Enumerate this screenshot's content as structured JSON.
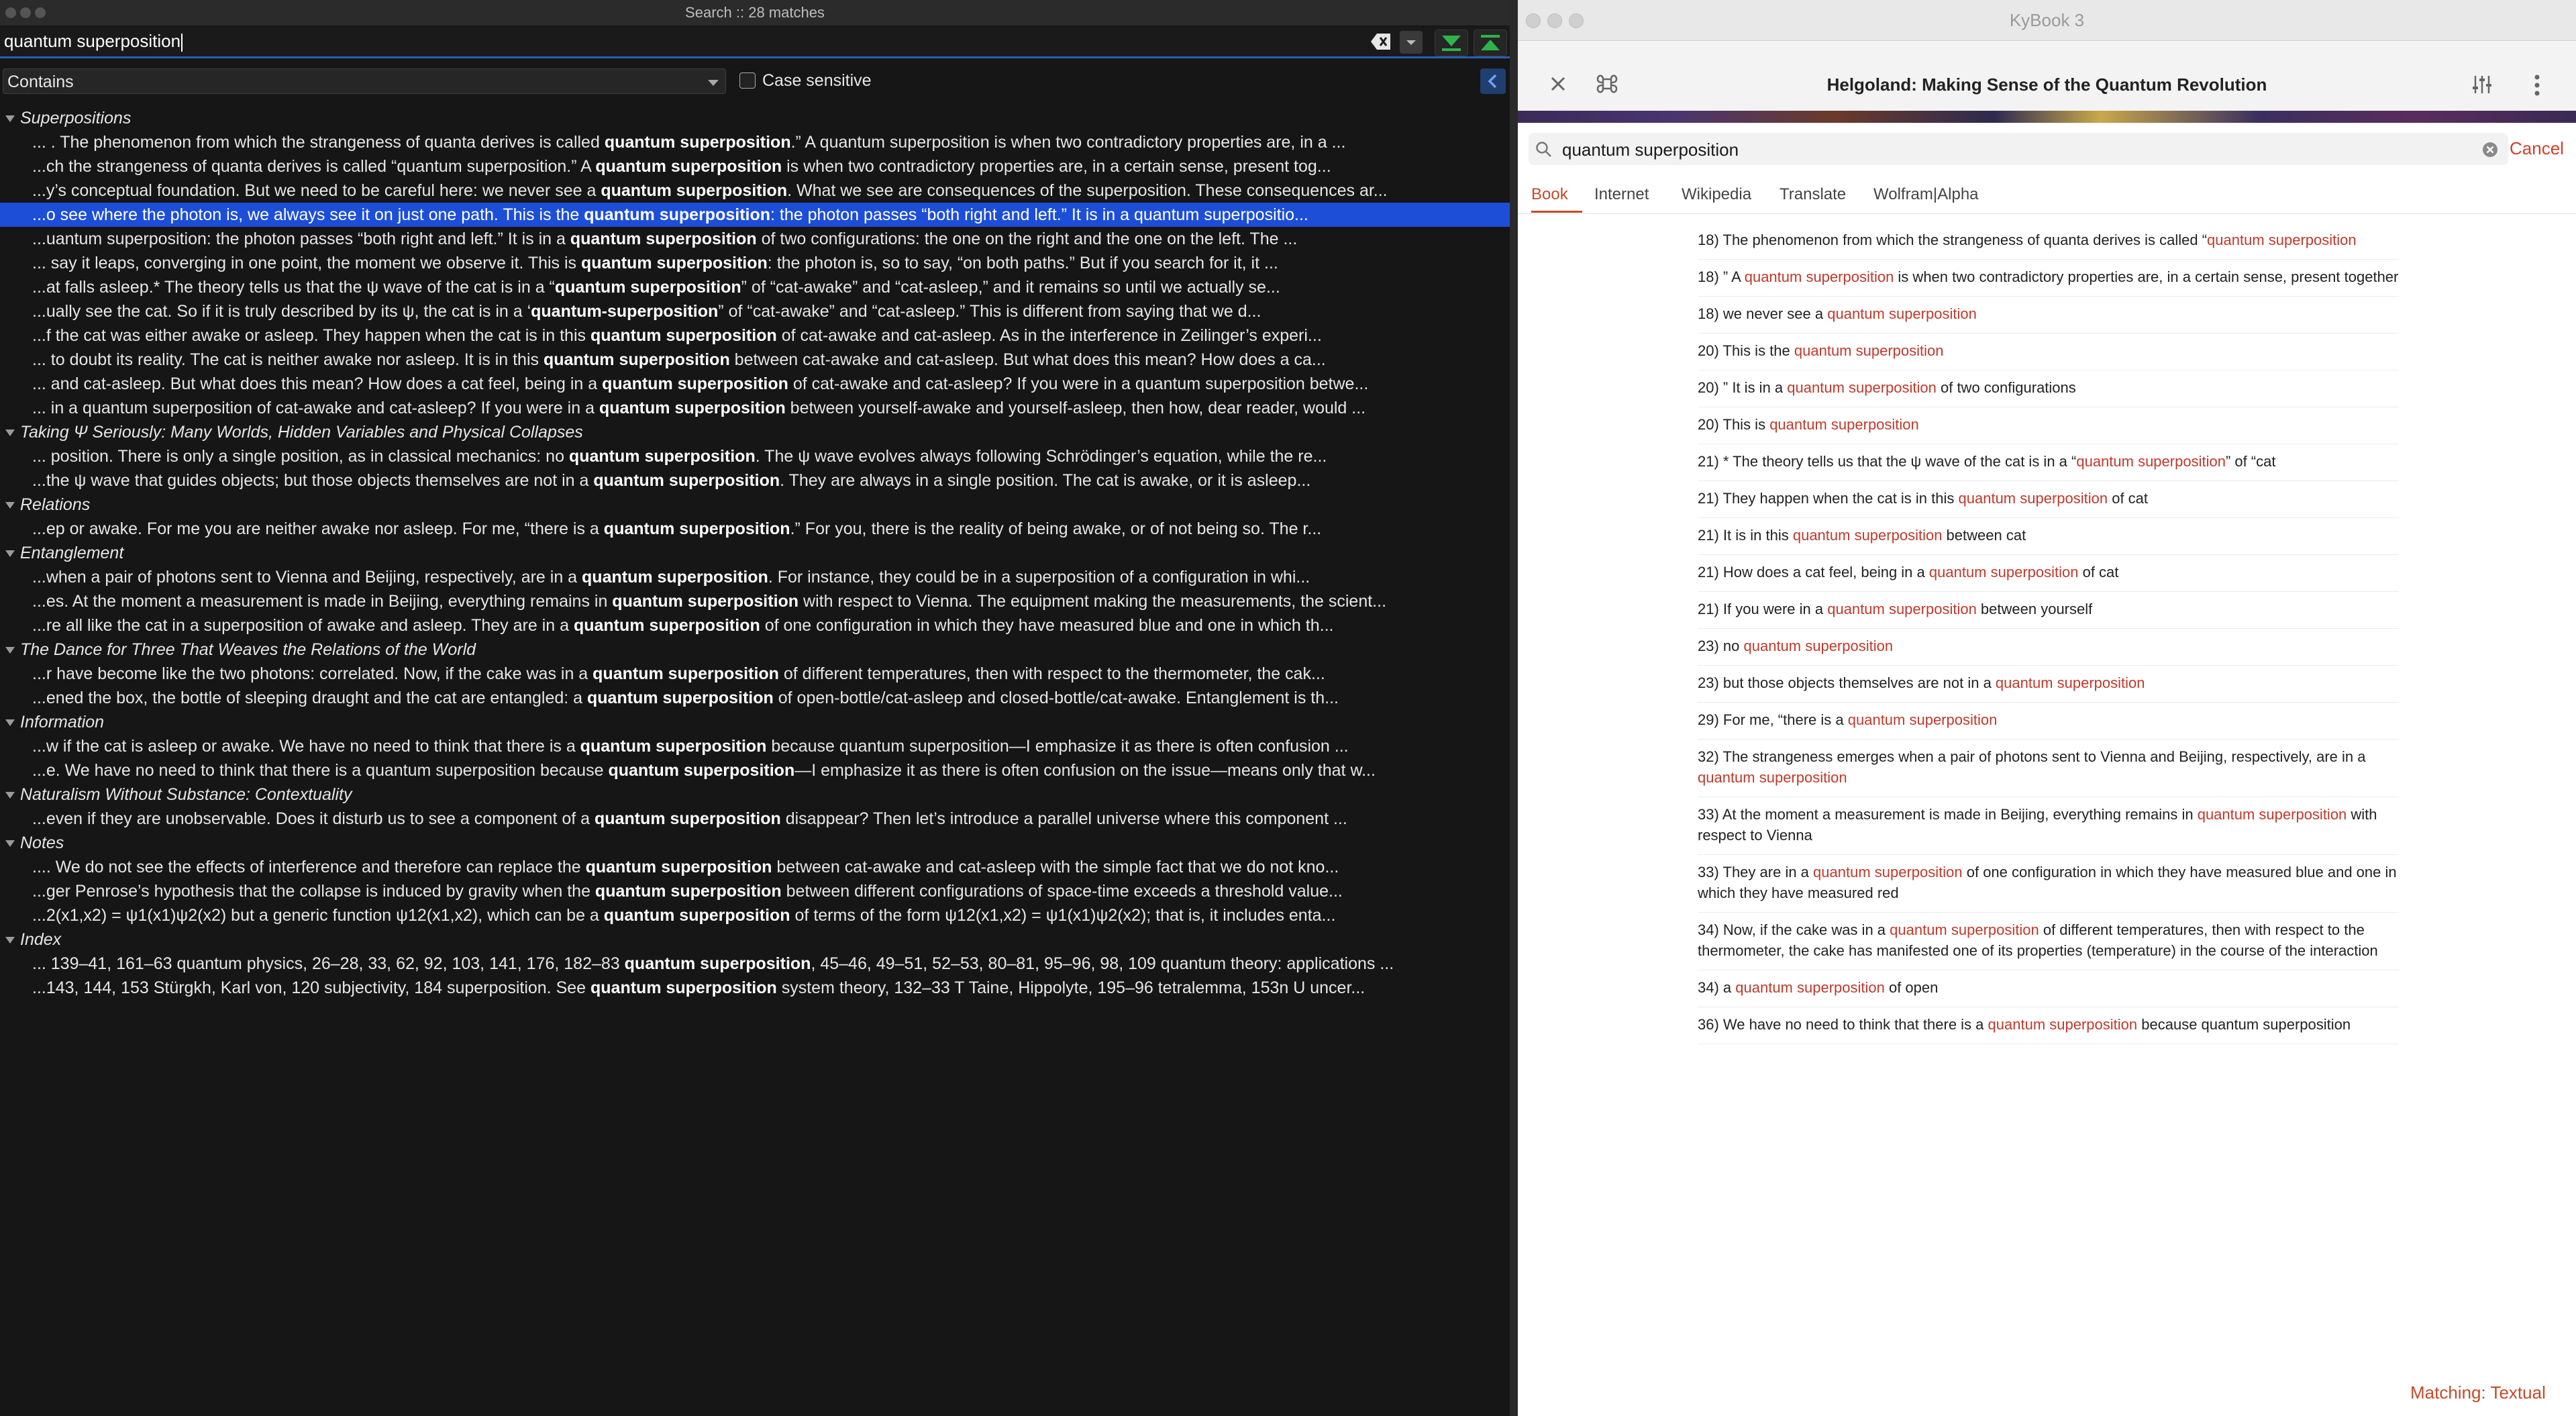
{
  "left_window": {
    "title": "Search :: 28 matches",
    "search_value": "quantum superposition",
    "mode": "Contains",
    "case_label": "Case sensitive",
    "groups": [
      {
        "title": "Superpositions",
        "hits": [
          {
            "pre": "... . The phenomenon from which the strangeness of quanta derives is called  ",
            "match": "quantum superposition",
            "post": ".” A quantum superposition is when two contradictory properties are, in a ..."
          },
          {
            "pre": "...ch the strangeness of quanta derives is called “quantum superposition.” A ",
            "match": "quantum superposition",
            "post": " is when two contradictory properties are, in a certain sense, present tog..."
          },
          {
            "pre": "...y’s conceptual foundation. But we need to be careful here: we never see a ",
            "match": "quantum superposition",
            "post": ". What we see are consequences of the superposition. These consequences ar..."
          },
          {
            "pre": "...o see where the photon is, we always see it on just one path. This is the ",
            "match": "quantum superposition",
            "post": ": the photon passes “both right and left.” It is in a quantum superpositio...",
            "selected": true
          },
          {
            "pre": "...uantum superposition: the photon passes “both right and left.” It is in a ",
            "match": "quantum superposition",
            "post": " of two configurations: the one on the right and the one on the left. The ..."
          },
          {
            "pre": "... say it leaps, converging in one point, the moment we observe it. This is ",
            "match": "quantum superposition",
            "post": ": the photon is, so to say, “on both paths.” But if you search for it, it ..."
          },
          {
            "pre": "...at falls asleep.* The theory tells us that the ψ wave of the cat is in a “",
            "match": "quantum superposition",
            "post": "” of “cat-awake” and “cat-asleep,” and it remains so until we actually se..."
          },
          {
            "pre": "...ually see the cat. So if it is truly described by its ψ, the cat is in a ‘",
            "match": "quantum-superposition",
            "post": "” of “cat-awake” and “cat-asleep.” This is different from saying that we d..."
          },
          {
            "pre": "...f the cat was either awake or asleep. They happen when the cat is in this ",
            "match": "quantum superposition",
            "post": " of cat-awake and cat-asleep. As in the interference in Zeilinger’s experi..."
          },
          {
            "pre": "... to doubt its reality. The cat is neither awake nor asleep. It is in this ",
            "match": "quantum superposition",
            "post": " between cat-awake and cat-asleep. But what does this mean? How does a ca..."
          },
          {
            "pre": "... and cat-asleep. But what does this mean? How does a cat feel, being in a ",
            "match": "quantum superposition",
            "post": " of cat-awake and cat-asleep? If you were in a quantum superposition betwe..."
          },
          {
            "pre": "... in a quantum superposition of cat-awake and cat-asleep? If you were in a ",
            "match": "quantum superposition",
            "post": " between yourself-awake and yourself-asleep, then how, dear reader, would ..."
          }
        ]
      },
      {
        "title": "Taking Ψ Seriously: Many Worlds, Hidden Variables and Physical Collapses",
        "hits": [
          {
            "pre": "... position. There is only a single position, as in classical mechanics: no ",
            "match": "quantum superposition",
            "post": ". The ψ wave evolves always following Schrödinger’s equation, while the re..."
          },
          {
            "pre": "...the ψ wave that guides objects; but those objects themselves are not in a ",
            "match": "quantum superposition",
            "post": ". They are always in a single position. The cat is awake, or it is asleep..."
          }
        ]
      },
      {
        "title": "Relations",
        "hits": [
          {
            "pre": "...ep or awake. For me you are neither awake nor asleep. For me, “there is a ",
            "match": "quantum superposition",
            "post": ".” For you, there is the reality of being awake, or of not being so. The r..."
          }
        ]
      },
      {
        "title": "Entanglement",
        "hits": [
          {
            "pre": "...when a pair of photons sent to Vienna and Beijing, respectively, are in a ",
            "match": "quantum superposition",
            "post": ". For instance, they could be in a superposition of a configuration in whi..."
          },
          {
            "pre": "...es. At the moment a measurement is made in Beijing, everything remains in ",
            "match": "quantum superposition",
            "post": " with respect to Vienna. The equipment making the measurements, the scient..."
          },
          {
            "pre": "...re all like the cat in a superposition of awake and asleep. They are in a ",
            "match": "quantum superposition",
            "post": " of one configuration in which they have measured blue and one in which th..."
          }
        ]
      },
      {
        "title": "The Dance for Three That Weaves the Relations of the World",
        "hits": [
          {
            "pre": "...r have become like the two photons: correlated. Now, if the cake was in a ",
            "match": "quantum superposition",
            "post": " of different temperatures, then with respect to the thermometer, the cak..."
          },
          {
            "pre": "...ened the box, the bottle of sleeping draught and the cat are entangled: a ",
            "match": "quantum superposition",
            "post": " of open-bottle/cat-asleep and closed-bottle/cat-awake. Entanglement is th..."
          }
        ]
      },
      {
        "title": "Information",
        "hits": [
          {
            "pre": "...w if the cat is asleep or awake. We have no need to think that there is a ",
            "match": "quantum superposition",
            "post": " because quantum superposition—I emphasize it as there is often confusion ..."
          },
          {
            "pre": "...e. We have no need to think that there is a quantum superposition because ",
            "match": "quantum superposition",
            "post": "—I emphasize it as there is often confusion on the issue—means only that w..."
          }
        ]
      },
      {
        "title": "Naturalism Without Substance: Contextuality",
        "hits": [
          {
            "pre": "...even if they are unobservable. Does it disturb us to see a component of a ",
            "match": "quantum superposition",
            "post": " disappear? Then let’s introduce a parallel universe where this component ..."
          }
        ]
      },
      {
        "title": "Notes",
        "hits": [
          {
            "pre": ".... We do not see the effects of interference and therefore can replace the ",
            "match": "quantum superposition",
            "post": " between cat-awake and cat-asleep with the simple fact that we do not kno..."
          },
          {
            "pre": "...ger Penrose’s hypothesis that the collapse is induced by gravity when the ",
            "match": "quantum superposition",
            "post": " between different configurations of space-time exceeds a threshold value..."
          },
          {
            "pre": "...2(x1,x2) = ψ1(x1)ψ2(x2) but a generic function ψ12(x1,x2), which can be a ",
            "match": "quantum superposition",
            "post": " of terms of the form ψ12(x1,x2) = ψ1(x1)ψ2(x2); that is, it includes enta..."
          }
        ]
      },
      {
        "title": "Index",
        "hits": [
          {
            "pre": "... 139–41, 161–63 quantum physics, 26–28, 33, 62, 92, 103, 141, 176, 182–83 ",
            "match": "quantum superposition",
            "post": ", 45–46, 49–51, 52–53, 80–81, 95–96, 98, 109 quantum theory: applications ..."
          },
          {
            "pre": "...143, 144, 153 Stürgkh, Karl von, 120 subjectivity, 184 superposition. See ",
            "match": "quantum superposition",
            "post": " system theory, 132–33 T Taine, Hippolyte, 195–96 tetralemma, 153n U uncer..."
          }
        ]
      }
    ]
  },
  "right_window": {
    "app_title": "KyBook 3",
    "book_title": "Helgoland: Making Sense of the Quantum Revolution",
    "search_value": "quantum superposition",
    "cancel_label": "Cancel",
    "tabs": [
      "Book",
      "Internet",
      "Wikipedia",
      "Translate",
      "Wolfram|Alpha"
    ],
    "active_tab": "Book",
    "hits": [
      {
        "pre": "18) The phenomenon from which the strangeness of quanta derives is called “",
        "match": "quantum superposition",
        "post": ""
      },
      {
        "pre": "18) ” A ",
        "match": "quantum superposition",
        "post": " is when two contradictory properties are, in a certain sense, present together"
      },
      {
        "pre": "18)  we never see a ",
        "match": "quantum superposition",
        "post": ""
      },
      {
        "pre": "20) This is the ",
        "match": "quantum superposition",
        "post": ""
      },
      {
        "pre": "20) ” It is in a ",
        "match": "quantum superposition",
        "post": " of two configurations"
      },
      {
        "pre": "20) This is ",
        "match": "quantum superposition",
        "post": ""
      },
      {
        "pre": "21) * The theory tells us that the ψ wave of the cat is in a “",
        "match": "quantum superposition",
        "post": "” of “cat"
      },
      {
        "pre": "21)  They happen when the cat is in this ",
        "match": "quantum superposition",
        "post": " of cat"
      },
      {
        "pre": "21)  It is in this ",
        "match": "quantum superposition",
        "post": " between cat"
      },
      {
        "pre": "21) How does a cat feel, being in a ",
        "match": "quantum superposition",
        "post": " of cat"
      },
      {
        "pre": "21)  If you were in a ",
        "match": "quantum superposition",
        "post": " between yourself"
      },
      {
        "pre": "23)  no ",
        "match": "quantum superposition",
        "post": ""
      },
      {
        "pre": "23)  but those objects themselves are not in a ",
        "match": "quantum superposition",
        "post": ""
      },
      {
        "pre": "29)  For me, “there is a ",
        "match": "quantum superposition",
        "post": ""
      },
      {
        "pre": "32) The strangeness emerges when a pair of photons sent to Vienna and Beijing, respectively, are in a ",
        "match": "quantum superposition",
        "post": ""
      },
      {
        "pre": "33) At the moment a measurement is made in Beijing, everything remains in ",
        "match": "quantum superposition",
        "post": " with respect to Vienna"
      },
      {
        "pre": "33)  They are in a ",
        "match": "quantum superposition",
        "post": " of one configuration in which they have measured blue and one in which they have measured red"
      },
      {
        "pre": "34) Now, if the cake was in a ",
        "match": "quantum superposition",
        "post": " of different temperatures, then with respect to the thermometer, the cake has manifested one of its properties (temperature) in the course of the interaction"
      },
      {
        "pre": "34)  a ",
        "match": "quantum superposition",
        "post": " of open"
      },
      {
        "pre": "36)  We have no need to think that there is a ",
        "match": "quantum superposition",
        "post": " because quantum superposition"
      }
    ],
    "matching_label": "Matching: Textual"
  },
  "colors": {
    "selection": "#1d4ed8",
    "accent": "#c44a2a",
    "match_red": "#c0392b",
    "nav_green": "#2fb44a"
  }
}
